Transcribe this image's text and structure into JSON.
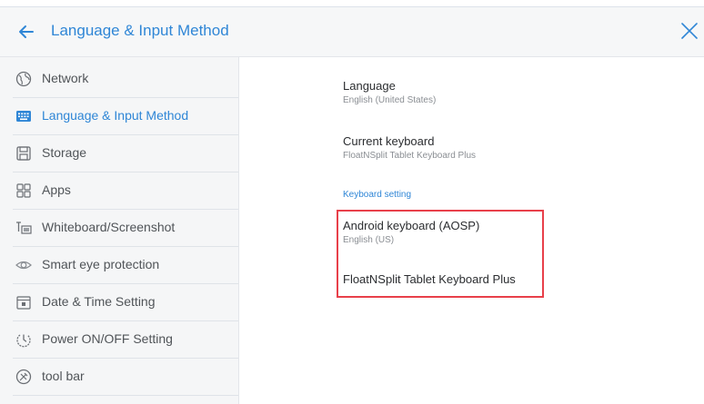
{
  "header": {
    "title": "Language & Input Method",
    "accent_color": "#2f86d6",
    "back_icon": "arrow-left-icon",
    "close_icon": "close-icon"
  },
  "sidebar": {
    "items": [
      {
        "label": "Network",
        "icon": "globe-icon"
      },
      {
        "label": "Language & Input Method",
        "icon": "keyboard-icon",
        "active": true
      },
      {
        "label": "Storage",
        "icon": "storage-icon"
      },
      {
        "label": "Apps",
        "icon": "apps-grid-icon"
      },
      {
        "label": "Whiteboard/Screenshot",
        "icon": "whiteboard-icon"
      },
      {
        "label": "Smart eye protection",
        "icon": "eye-icon"
      },
      {
        "label": "Date & Time Setting",
        "icon": "calendar-icon"
      },
      {
        "label": "Power ON/OFF Setting",
        "icon": "power-icon"
      },
      {
        "label": "tool bar",
        "icon": "toolbar-icon"
      }
    ]
  },
  "content": {
    "language": {
      "title": "Language",
      "value": "English (United States)"
    },
    "current_keyboard": {
      "title": "Current keyboard",
      "value": "FloatNSplit Tablet Keyboard Plus"
    },
    "section_label": "Keyboard setting",
    "keyboards": [
      {
        "title": "Android keyboard (AOSP)",
        "subtitle": "English (US)"
      },
      {
        "title": "FloatNSplit Tablet Keyboard Plus"
      }
    ],
    "highlight_color": "#e8404a"
  }
}
